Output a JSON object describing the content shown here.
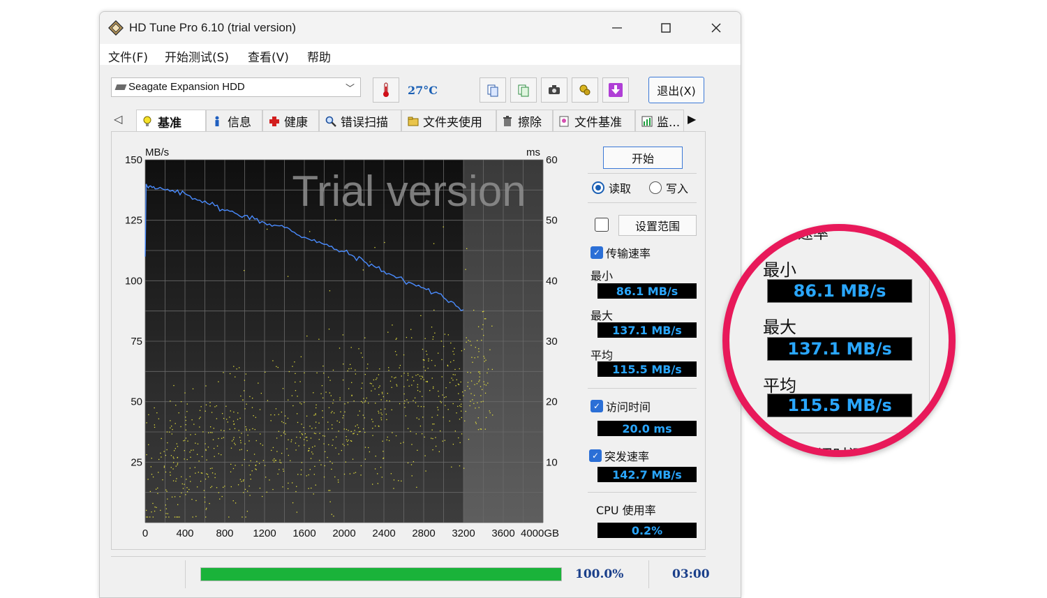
{
  "window": {
    "title": "HD Tune Pro 6.10 (trial version)",
    "minimize_glyph": "—",
    "maximize_glyph": "☐",
    "close_glyph": "✕"
  },
  "menu": [
    "文件(F)",
    "开始测试(S)",
    "查看(V)",
    "帮助"
  ],
  "toolbar": {
    "drive": "Seagate Expansion HDD",
    "temperature": "27°C",
    "exit_label": "退出(X)"
  },
  "tabs": [
    "基准",
    "信息",
    "健康",
    "错误扫描",
    "文件夹使用",
    "擦除",
    "文件基准",
    "监..."
  ],
  "chart_data": {
    "type": "line",
    "watermark": "Trial version",
    "left_unit": "MB/s",
    "right_unit": "ms",
    "x_unit": "GB",
    "xlim": [
      0,
      4000
    ],
    "ylim_left": [
      0,
      150
    ],
    "ylim_right": [
      0,
      60
    ],
    "x_ticks": [
      "0",
      "400",
      "800",
      "1200",
      "1600",
      "2000",
      "2400",
      "2800",
      "3200",
      "3600",
      "4000GB"
    ],
    "y_ticks_left": [
      "150",
      "125",
      "100",
      "75",
      "50",
      "25"
    ],
    "y_ticks_right": [
      "60",
      "50",
      "40",
      "30",
      "20",
      "10"
    ],
    "completed_until": 3200,
    "series": [
      {
        "role": "transfer",
        "axis": "left",
        "color": "#4a8cff",
        "x": [
          0,
          10,
          40,
          100,
          200,
          300,
          400,
          500,
          600,
          700,
          800,
          900,
          1000,
          1100,
          1200,
          1300,
          1400,
          1500,
          1600,
          1700,
          1800,
          1900,
          2000,
          2100,
          2200,
          2300,
          2400,
          2500,
          2600,
          2700,
          2800,
          2900,
          3000,
          3100,
          3200
        ],
        "y": [
          110,
          140,
          139,
          138,
          137.5,
          136.5,
          136,
          134,
          133,
          131,
          129,
          128,
          127,
          125.5,
          124,
          123,
          122,
          120,
          118,
          117,
          115,
          113,
          112,
          110,
          108,
          106,
          104,
          102,
          100,
          98.5,
          97,
          95,
          93,
          91,
          88
        ]
      },
      {
        "role": "access",
        "axis": "right",
        "color": "#e6e13c",
        "points": "scatter of access times, mostly 5–30 ms"
      }
    ]
  },
  "controls": {
    "start_label": "开始",
    "read_label": "读取",
    "write_label": "写入",
    "set_range_label": "设置范围",
    "transfer_label": "传输速率",
    "min_label": "最小",
    "min_value": "86.1 MB/s",
    "max_label": "最大",
    "max_value": "137.1 MB/s",
    "avg_label": "平均",
    "avg_value": "115.5 MB/s",
    "access_label": "访问时间",
    "access_value": "20.0 ms",
    "burst_label": "突发速率",
    "burst_value": "142.7 MB/s",
    "cpu_label": "CPU 使用率",
    "cpu_value": "0.2%"
  },
  "status": {
    "progress": 1.0,
    "progress_text": "100.0%",
    "time": "03:00"
  },
  "zoom": {
    "top_partial": "速率",
    "min_label": "最小",
    "min_value": "86.1 MB/s",
    "max_label": "最大",
    "max_value": "137.1 MB/s",
    "avg_label": "平均",
    "avg_value": "115.5 MB/s",
    "bottom_partial": "访问时间"
  }
}
